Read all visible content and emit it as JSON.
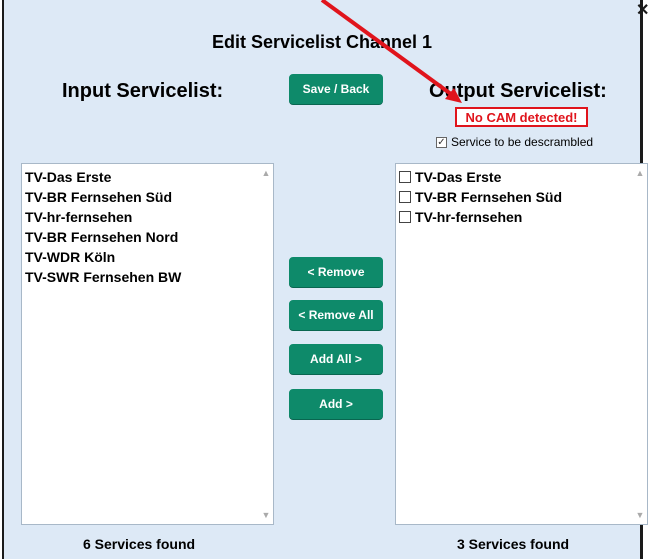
{
  "dialog": {
    "title": "Edit Servicelist Channel 1",
    "input_header": "Input Servicelist:",
    "output_header": "Output Servicelist:",
    "no_cam": "No CAM detected!",
    "descramble_label": "Service to be descrambled",
    "descramble_checked": true
  },
  "buttons": {
    "save_back": "Save / Back",
    "remove": "< Remove",
    "remove_all": "< Remove All",
    "add_all": "Add All >",
    "add": "Add >"
  },
  "input_list": {
    "items": [
      "TV-Das Erste",
      "TV-BR Fernsehen Süd",
      "TV-hr-fernsehen",
      "TV-BR Fernsehen Nord",
      "TV-WDR Köln",
      "TV-SWR Fernsehen BW"
    ],
    "count_text": "6 Services found"
  },
  "output_list": {
    "items": [
      "TV-Das Erste",
      "TV-BR Fernsehen Süd",
      "TV-hr-fernsehen"
    ],
    "count_text": "3 Services found"
  },
  "colors": {
    "panel_bg": "#dde9f6",
    "button_bg": "#0e8a6a",
    "alert_red": "#e0141c"
  }
}
